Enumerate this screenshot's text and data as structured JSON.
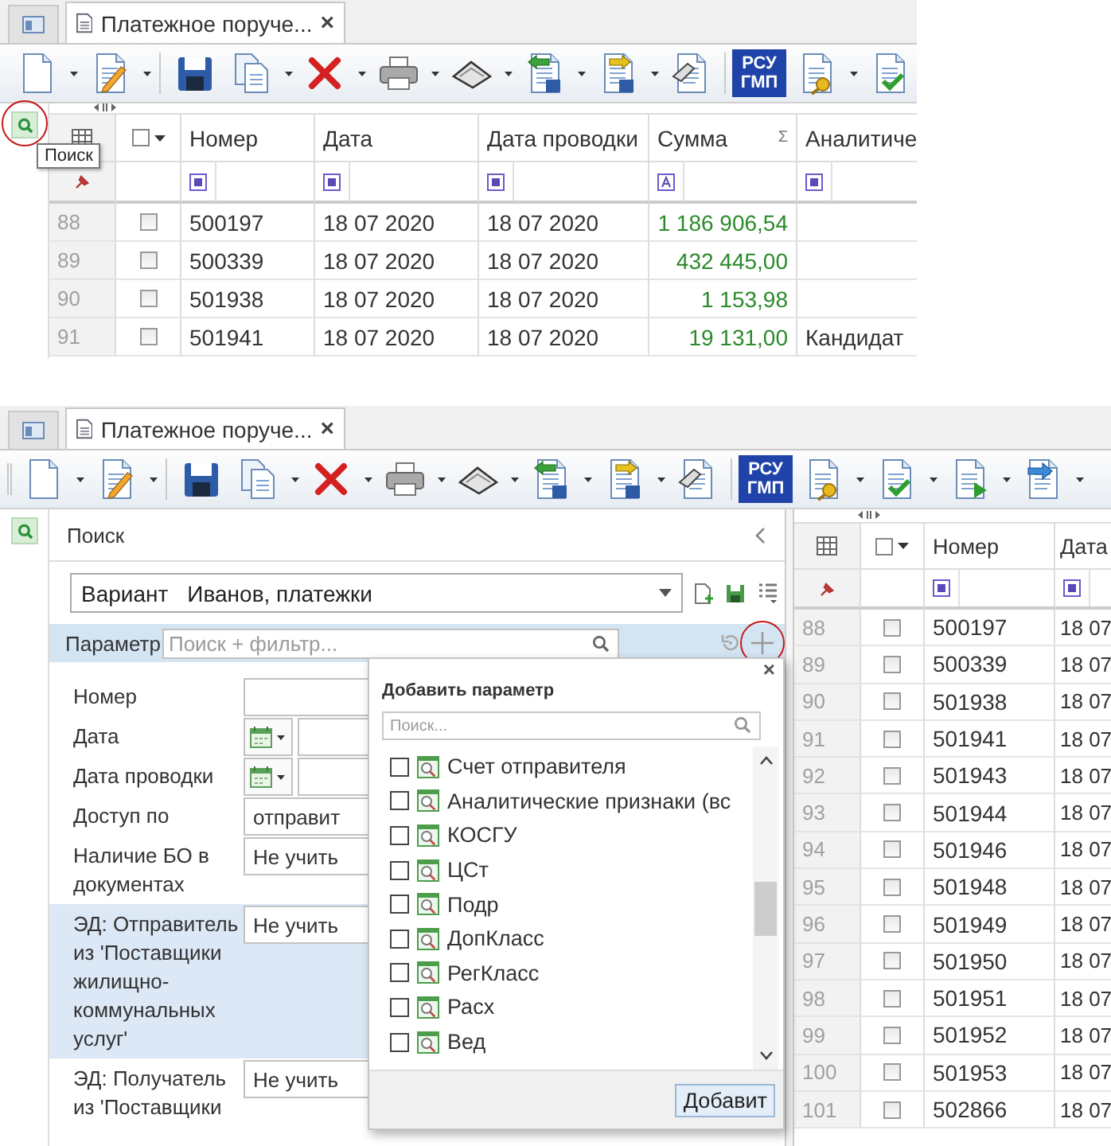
{
  "top": {
    "tab": {
      "title": "Платежное поруче...",
      "close": "×"
    },
    "toolbar": {
      "badge": [
        "РСУ",
        "ГМП"
      ]
    },
    "search_button": {
      "tooltip": "Поиск"
    },
    "table": {
      "select_all": {
        "checked": false
      },
      "columns": [
        "Номер",
        "Дата",
        "Дата проводки",
        "Сумма",
        "Аналитиче"
      ],
      "sum_sign": "Σ",
      "rows": [
        {
          "row": "88",
          "checked": false,
          "number": "500197",
          "date": "18 07 2020",
          "posting_date": "18 07 2020",
          "amount": "1 186 906,54"
        },
        {
          "row": "89",
          "checked": false,
          "number": "500339",
          "date": "18 07 2020",
          "posting_date": "18 07 2020",
          "amount": "432 445,00"
        },
        {
          "row": "90",
          "checked": false,
          "number": "501938",
          "date": "18 07 2020",
          "posting_date": "18 07 2020",
          "amount": "1 153,98"
        },
        {
          "row": "91",
          "checked": false,
          "number": "501941",
          "date": "18 07 2020",
          "posting_date": "18 07 2020",
          "amount": "19 131,00",
          "analytics": "Кандидат"
        }
      ]
    }
  },
  "bottom": {
    "tab": {
      "title": "Платежное поруче...",
      "close": "×"
    },
    "toolbar": {
      "badge": [
        "РСУ",
        "ГМП"
      ]
    },
    "search_panel": {
      "title": "Поиск",
      "variant": {
        "label": "Вариант",
        "value": "Иванов, платежки"
      },
      "parameters": {
        "label": "Параметр",
        "placeholder": "Поиск + фильтр..."
      },
      "fields": [
        {
          "label": "Номер",
          "kind": "text",
          "selected": false
        },
        {
          "label": "Дата",
          "kind": "date",
          "selected": false
        },
        {
          "label": "Дата проводки",
          "kind": "date",
          "selected": false
        },
        {
          "label": "Доступ по",
          "kind": "select",
          "value": "отправит",
          "selected": false
        },
        {
          "label": "Наличие БО в документах",
          "kind": "select",
          "value": "Не учить",
          "selected": false
        },
        {
          "label": "ЭД: Отправитель из 'Поставщики жилищно-коммунальных услуг'",
          "kind": "select",
          "value": "Не учить",
          "selected": true
        },
        {
          "label": "ЭД: Получатель из 'Поставщики",
          "kind": "select",
          "value": "Не учить",
          "selected": false
        }
      ]
    },
    "add_parameter_popup": {
      "title": "Добавить параметр",
      "close": "×",
      "search_placeholder": "Поиск...",
      "items": [
        {
          "label": "Счет отправителя",
          "checked": false
        },
        {
          "label": "Аналитические признаки (вс",
          "checked": false
        },
        {
          "label": "КОСГУ",
          "checked": false
        },
        {
          "label": "ЦСт",
          "checked": false
        },
        {
          "label": "Подр",
          "checked": false
        },
        {
          "label": "ДопКласс",
          "checked": false
        },
        {
          "label": "РегКласс",
          "checked": false
        },
        {
          "label": "Расх",
          "checked": false
        },
        {
          "label": "Вед",
          "checked": false
        }
      ],
      "button": "Добавит"
    },
    "table": {
      "select_all": {
        "checked": false
      },
      "columns": [
        "Номер",
        "Дата"
      ],
      "rows": [
        {
          "row": "88",
          "checked": false,
          "number": "500197",
          "date": "18 07"
        },
        {
          "row": "89",
          "checked": false,
          "number": "500339",
          "date": "18 07"
        },
        {
          "row": "90",
          "checked": false,
          "number": "501938",
          "date": "18 07"
        },
        {
          "row": "91",
          "checked": false,
          "number": "501941",
          "date": "18 07"
        },
        {
          "row": "92",
          "checked": false,
          "number": "501943",
          "date": "18 07"
        },
        {
          "row": "93",
          "checked": false,
          "number": "501944",
          "date": "18 07"
        },
        {
          "row": "94",
          "checked": false,
          "number": "501946",
          "date": "18 07"
        },
        {
          "row": "95",
          "checked": false,
          "number": "501948",
          "date": "18 07"
        },
        {
          "row": "96",
          "checked": false,
          "number": "501949",
          "date": "18 07"
        },
        {
          "row": "97",
          "checked": false,
          "number": "501950",
          "date": "18 07"
        },
        {
          "row": "98",
          "checked": false,
          "number": "501951",
          "date": "18 07"
        },
        {
          "row": "99",
          "checked": false,
          "number": "501952",
          "date": "18 07"
        },
        {
          "row": "100",
          "checked": false,
          "number": "501953",
          "date": "18 07"
        },
        {
          "row": "101",
          "checked": false,
          "number": "502866",
          "date": "18 07"
        }
      ]
    }
  }
}
